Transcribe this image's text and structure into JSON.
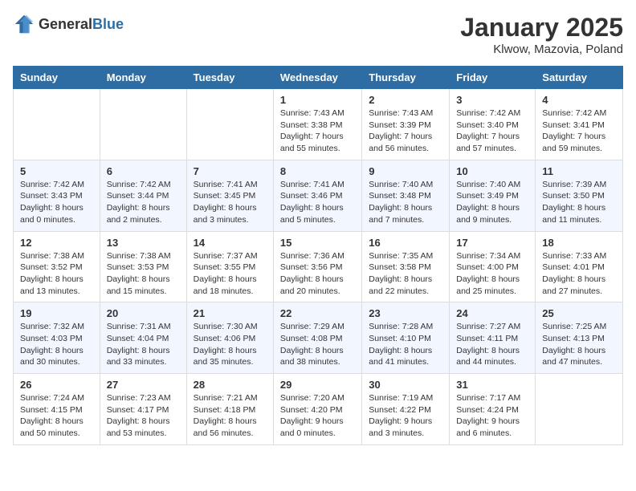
{
  "logo": {
    "general": "General",
    "blue": "Blue"
  },
  "header": {
    "month": "January 2025",
    "location": "Klwow, Mazovia, Poland"
  },
  "weekdays": [
    "Sunday",
    "Monday",
    "Tuesday",
    "Wednesday",
    "Thursday",
    "Friday",
    "Saturday"
  ],
  "weeks": [
    [
      {
        "day": "",
        "info": ""
      },
      {
        "day": "",
        "info": ""
      },
      {
        "day": "",
        "info": ""
      },
      {
        "day": "1",
        "info": "Sunrise: 7:43 AM\nSunset: 3:38 PM\nDaylight: 7 hours and 55 minutes."
      },
      {
        "day": "2",
        "info": "Sunrise: 7:43 AM\nSunset: 3:39 PM\nDaylight: 7 hours and 56 minutes."
      },
      {
        "day": "3",
        "info": "Sunrise: 7:42 AM\nSunset: 3:40 PM\nDaylight: 7 hours and 57 minutes."
      },
      {
        "day": "4",
        "info": "Sunrise: 7:42 AM\nSunset: 3:41 PM\nDaylight: 7 hours and 59 minutes."
      }
    ],
    [
      {
        "day": "5",
        "info": "Sunrise: 7:42 AM\nSunset: 3:43 PM\nDaylight: 8 hours and 0 minutes."
      },
      {
        "day": "6",
        "info": "Sunrise: 7:42 AM\nSunset: 3:44 PM\nDaylight: 8 hours and 2 minutes."
      },
      {
        "day": "7",
        "info": "Sunrise: 7:41 AM\nSunset: 3:45 PM\nDaylight: 8 hours and 3 minutes."
      },
      {
        "day": "8",
        "info": "Sunrise: 7:41 AM\nSunset: 3:46 PM\nDaylight: 8 hours and 5 minutes."
      },
      {
        "day": "9",
        "info": "Sunrise: 7:40 AM\nSunset: 3:48 PM\nDaylight: 8 hours and 7 minutes."
      },
      {
        "day": "10",
        "info": "Sunrise: 7:40 AM\nSunset: 3:49 PM\nDaylight: 8 hours and 9 minutes."
      },
      {
        "day": "11",
        "info": "Sunrise: 7:39 AM\nSunset: 3:50 PM\nDaylight: 8 hours and 11 minutes."
      }
    ],
    [
      {
        "day": "12",
        "info": "Sunrise: 7:38 AM\nSunset: 3:52 PM\nDaylight: 8 hours and 13 minutes."
      },
      {
        "day": "13",
        "info": "Sunrise: 7:38 AM\nSunset: 3:53 PM\nDaylight: 8 hours and 15 minutes."
      },
      {
        "day": "14",
        "info": "Sunrise: 7:37 AM\nSunset: 3:55 PM\nDaylight: 8 hours and 18 minutes."
      },
      {
        "day": "15",
        "info": "Sunrise: 7:36 AM\nSunset: 3:56 PM\nDaylight: 8 hours and 20 minutes."
      },
      {
        "day": "16",
        "info": "Sunrise: 7:35 AM\nSunset: 3:58 PM\nDaylight: 8 hours and 22 minutes."
      },
      {
        "day": "17",
        "info": "Sunrise: 7:34 AM\nSunset: 4:00 PM\nDaylight: 8 hours and 25 minutes."
      },
      {
        "day": "18",
        "info": "Sunrise: 7:33 AM\nSunset: 4:01 PM\nDaylight: 8 hours and 27 minutes."
      }
    ],
    [
      {
        "day": "19",
        "info": "Sunrise: 7:32 AM\nSunset: 4:03 PM\nDaylight: 8 hours and 30 minutes."
      },
      {
        "day": "20",
        "info": "Sunrise: 7:31 AM\nSunset: 4:04 PM\nDaylight: 8 hours and 33 minutes."
      },
      {
        "day": "21",
        "info": "Sunrise: 7:30 AM\nSunset: 4:06 PM\nDaylight: 8 hours and 35 minutes."
      },
      {
        "day": "22",
        "info": "Sunrise: 7:29 AM\nSunset: 4:08 PM\nDaylight: 8 hours and 38 minutes."
      },
      {
        "day": "23",
        "info": "Sunrise: 7:28 AM\nSunset: 4:10 PM\nDaylight: 8 hours and 41 minutes."
      },
      {
        "day": "24",
        "info": "Sunrise: 7:27 AM\nSunset: 4:11 PM\nDaylight: 8 hours and 44 minutes."
      },
      {
        "day": "25",
        "info": "Sunrise: 7:25 AM\nSunset: 4:13 PM\nDaylight: 8 hours and 47 minutes."
      }
    ],
    [
      {
        "day": "26",
        "info": "Sunrise: 7:24 AM\nSunset: 4:15 PM\nDaylight: 8 hours and 50 minutes."
      },
      {
        "day": "27",
        "info": "Sunrise: 7:23 AM\nSunset: 4:17 PM\nDaylight: 8 hours and 53 minutes."
      },
      {
        "day": "28",
        "info": "Sunrise: 7:21 AM\nSunset: 4:18 PM\nDaylight: 8 hours and 56 minutes."
      },
      {
        "day": "29",
        "info": "Sunrise: 7:20 AM\nSunset: 4:20 PM\nDaylight: 9 hours and 0 minutes."
      },
      {
        "day": "30",
        "info": "Sunrise: 7:19 AM\nSunset: 4:22 PM\nDaylight: 9 hours and 3 minutes."
      },
      {
        "day": "31",
        "info": "Sunrise: 7:17 AM\nSunset: 4:24 PM\nDaylight: 9 hours and 6 minutes."
      },
      {
        "day": "",
        "info": ""
      }
    ]
  ]
}
